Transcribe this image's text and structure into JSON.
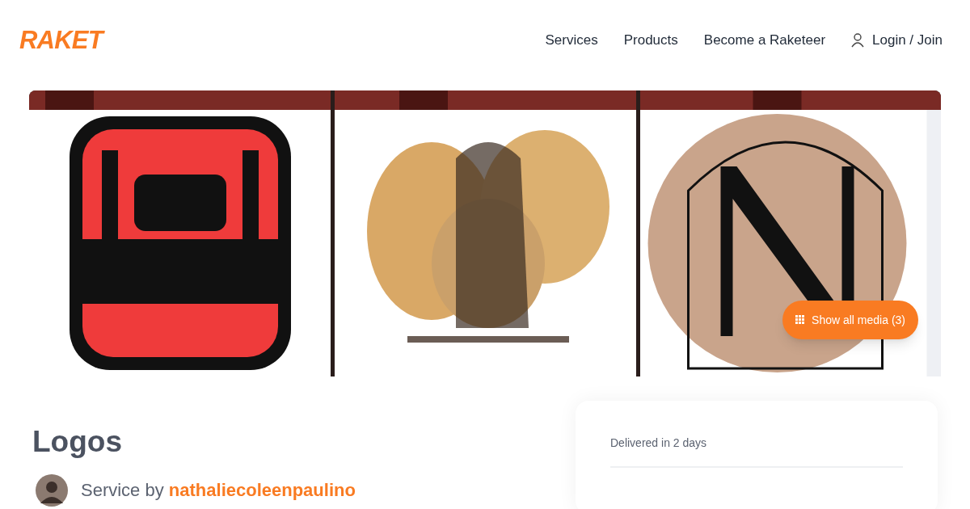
{
  "brand": "RAKET",
  "nav": [
    {
      "label": "Services",
      "kind": "link"
    },
    {
      "label": "Products",
      "kind": "link"
    },
    {
      "label": "Become a Raketeer",
      "kind": "link"
    },
    {
      "label": "Login / Join",
      "kind": "login"
    }
  ],
  "gallery": {
    "show_all_button": "Show all media (3)"
  },
  "title": "Logos",
  "service": {
    "prefix": "Service by",
    "seller": "nathaliecoleenpaulino"
  },
  "card": {
    "delivery": "Delivered in 2 days"
  }
}
